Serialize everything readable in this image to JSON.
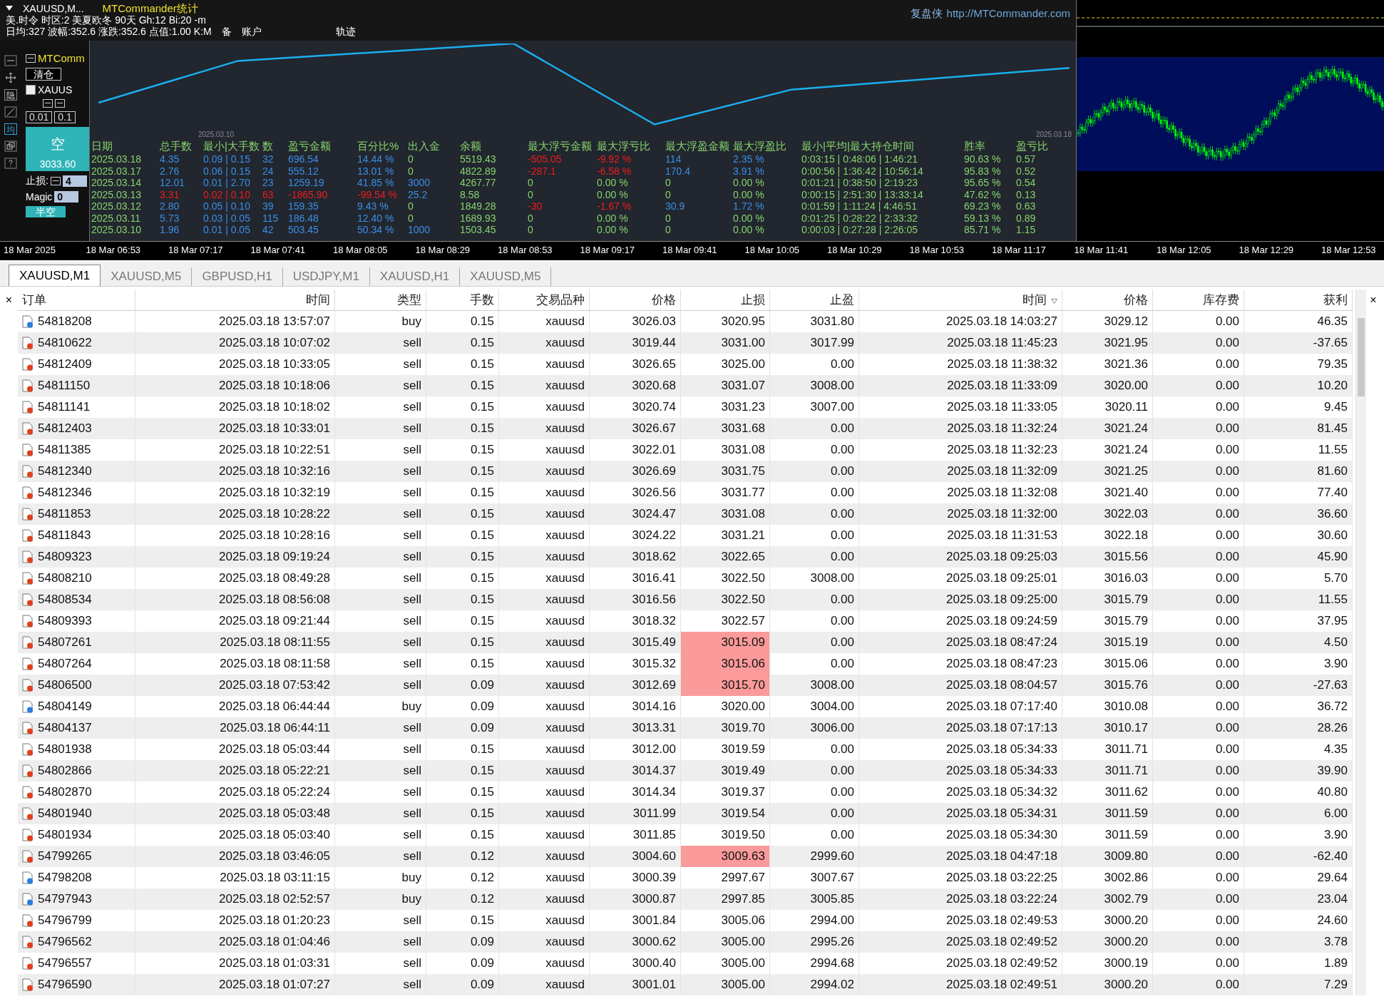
{
  "chart_header": {
    "symbol": "XAUUSD,M...",
    "title": "MTCommander统计",
    "line1": "美.时令  时区:2  美夏欧冬  90天  Gh:12 Bi:20  -m",
    "line2": [
      "日均:327  波幅:352.6  涨跌:352.6  点值:1.00  K:M",
      "备",
      "账户",
      "轨迹"
    ],
    "site_label": "复盘侠",
    "site_url": "http://MTCommander.com"
  },
  "tool_panel": {
    "title": "MTComm",
    "close_all": "清仓",
    "symbol_checkbox": {
      "label": "XAUUS",
      "checked": false
    },
    "lots": [
      "0.01",
      "0.1"
    ],
    "sell_button": {
      "label": "空",
      "price": "3033.60"
    },
    "stop_loss_label": "止损:",
    "stop_loss_value": "4",
    "magic_label": "Magic",
    "magic_value": "0",
    "half_short": "半空",
    "tool_glyphs": [
      "隐",
      "均"
    ]
  },
  "equity_chart": {
    "start_date": "2025.03.10",
    "end_date": "2025.03.18"
  },
  "stats": {
    "columns": [
      "日期",
      "总手数",
      "最小|大手数",
      "数",
      "盈亏金额",
      "百分比%",
      "出入金",
      "余额",
      "最大浮亏金额",
      "最大浮亏比",
      "最大浮盈金额",
      "最大浮盈比",
      "最小|平均|最大持仓时间",
      "胜率",
      "盈亏比"
    ],
    "rows": [
      {
        "date": "2025.03.18",
        "lots": "4.35",
        "min_max": "0.09 | 0.15",
        "count": "32",
        "pnl": "696.54",
        "pct": "14.44 %",
        "flow": "0",
        "balance": "5519.43",
        "float_loss": "-505.05",
        "float_loss_pct": "-9.92 %",
        "float_profit": "114",
        "float_profit_pct": "2.35 %",
        "hold_times": "0:03:15 | 0:48:06 | 1:46:21",
        "win_rate": "90.63 %",
        "pl_ratio": "0.57",
        "losing": false,
        "has_flow": false,
        "has_float_loss": true,
        "has_float_profit": true
      },
      {
        "date": "2025.03.17",
        "lots": "2.76",
        "min_max": "0.06 | 0.15",
        "count": "24",
        "pnl": "555.12",
        "pct": "13.01 %",
        "flow": "0",
        "balance": "4822.89",
        "float_loss": "-287.1",
        "float_loss_pct": "-6.58 %",
        "float_profit": "170.4",
        "float_profit_pct": "3.91 %",
        "hold_times": "0:00:56 | 1:36:42 | 10:56:14",
        "win_rate": "95.83 %",
        "pl_ratio": "0.52",
        "losing": false,
        "has_flow": false,
        "has_float_loss": true,
        "has_float_profit": true
      },
      {
        "date": "2025.03.14",
        "lots": "12.01",
        "min_max": "0.01 | 2.70",
        "count": "23",
        "pnl": "1259.19",
        "pct": "41.85 %",
        "flow": "3000",
        "balance": "4267.77",
        "float_loss": "0",
        "float_loss_pct": "0.00 %",
        "float_profit": "0",
        "float_profit_pct": "0.00 %",
        "hold_times": "0:01:21 | 0:38:50 | 2:19:23",
        "win_rate": "95.65 %",
        "pl_ratio": "0.54",
        "losing": false,
        "has_flow": true,
        "has_float_loss": false,
        "has_float_profit": false
      },
      {
        "date": "2025.03.13",
        "lots": "3.31",
        "min_max": "0.02 | 0.10",
        "count": "63",
        "pnl": "-1865.90",
        "pct": "-99.54 %",
        "flow": "25.2",
        "balance": "8.58",
        "float_loss": "0",
        "float_loss_pct": "0.00 %",
        "float_profit": "0",
        "float_profit_pct": "0.00 %",
        "hold_times": "0:00:15 | 2:51:30 | 13:33:14",
        "win_rate": "47.62 %",
        "pl_ratio": "0.13",
        "losing": true,
        "has_flow": true,
        "has_float_loss": false,
        "has_float_profit": false
      },
      {
        "date": "2025.03.12",
        "lots": "2.80",
        "min_max": "0.05 | 0.10",
        "count": "39",
        "pnl": "159.35",
        "pct": "9.43 %",
        "flow": "0",
        "balance": "1849.28",
        "float_loss": "-30",
        "float_loss_pct": "-1.67 %",
        "float_profit": "30.9",
        "float_profit_pct": "1.72 %",
        "hold_times": "0:01:59 | 1:11:24 | 4:46:51",
        "win_rate": "69.23 %",
        "pl_ratio": "0.63",
        "losing": false,
        "has_flow": false,
        "has_float_loss": true,
        "has_float_profit": true
      },
      {
        "date": "2025.03.11",
        "lots": "5.73",
        "min_max": "0.03 | 0.05",
        "count": "115",
        "pnl": "186.48",
        "pct": "12.40 %",
        "flow": "0",
        "balance": "1689.93",
        "float_loss": "0",
        "float_loss_pct": "0.00 %",
        "float_profit": "0",
        "float_profit_pct": "0.00 %",
        "hold_times": "0:01:25 | 0:28:22 | 2:33:32",
        "win_rate": "59.13 %",
        "pl_ratio": "0.89",
        "losing": false,
        "has_flow": false,
        "has_float_loss": false,
        "has_float_profit": false
      },
      {
        "date": "2025.03.10",
        "lots": "1.96",
        "min_max": "0.01 | 0.05",
        "count": "42",
        "pnl": "503.45",
        "pct": "50.34 %",
        "flow": "1000",
        "balance": "1503.45",
        "float_loss": "0",
        "float_loss_pct": "0.00 %",
        "float_profit": "0",
        "float_profit_pct": "0.00 %",
        "hold_times": "0:00:03 | 0:27:28 | 2:26:05",
        "win_rate": "85.71 %",
        "pl_ratio": "1.15",
        "losing": false,
        "has_flow": true,
        "has_float_loss": false,
        "has_float_profit": false
      }
    ]
  },
  "time_axis": [
    "18 Mar 2025",
    "18 Mar 06:53",
    "18 Mar 07:17",
    "18 Mar 07:41",
    "18 Mar 08:05",
    "18 Mar 08:29",
    "18 Mar 08:53",
    "18 Mar 09:17",
    "18 Mar 09:41",
    "18 Mar 10:05",
    "18 Mar 10:29",
    "18 Mar 10:53",
    "18 Mar 11:17",
    "18 Mar 11:41",
    "18 Mar 12:05",
    "18 Mar 12:29",
    "18 Mar 12:53"
  ],
  "tabs": [
    {
      "label": "XAUUSD,M1",
      "selected": true
    },
    {
      "label": "XAUUSD,M5",
      "selected": false
    },
    {
      "label": "GBPUSD,H1",
      "selected": false
    },
    {
      "label": "USDJPY,M1",
      "selected": false
    },
    {
      "label": "XAUUSD,H1",
      "selected": false
    },
    {
      "label": "XAUUSD,M5",
      "selected": false
    }
  ],
  "orders": {
    "close_glyphs": [
      "×",
      "×"
    ],
    "columns": [
      {
        "label": "订单",
        "sorted": false
      },
      {
        "label": "时间",
        "sorted": false
      },
      {
        "label": "类型",
        "sorted": false
      },
      {
        "label": "手数",
        "sorted": false
      },
      {
        "label": "交易品种",
        "sorted": false
      },
      {
        "label": "价格",
        "sorted": false
      },
      {
        "label": "止损",
        "sorted": false
      },
      {
        "label": "止盈",
        "sorted": false
      },
      {
        "label": "时间",
        "sorted": true
      },
      {
        "label": "价格",
        "sorted": false
      },
      {
        "label": "库存费",
        "sorted": false
      },
      {
        "label": "获利",
        "sorted": false
      }
    ],
    "rows": [
      {
        "order": "54818208",
        "kind": "buy",
        "open_time": "2025.03.18 13:57:07",
        "type": "buy",
        "lots": "0.15",
        "symbol": "xauusd",
        "price": "3026.03",
        "sl": "3020.95",
        "sl_hit": false,
        "tp": "3031.80",
        "close_time": "2025.03.18 14:03:27",
        "close_price": "3029.12",
        "swap": "0.00",
        "profit": "46.35"
      },
      {
        "order": "54810622",
        "kind": "sell",
        "open_time": "2025.03.18 10:07:02",
        "type": "sell",
        "lots": "0.15",
        "symbol": "xauusd",
        "price": "3019.44",
        "sl": "3031.00",
        "sl_hit": false,
        "tp": "3017.99",
        "close_time": "2025.03.18 11:45:23",
        "close_price": "3021.95",
        "swap": "0.00",
        "profit": "-37.65"
      },
      {
        "order": "54812409",
        "kind": "sell",
        "open_time": "2025.03.18 10:33:05",
        "type": "sell",
        "lots": "0.15",
        "symbol": "xauusd",
        "price": "3026.65",
        "sl": "3025.00",
        "sl_hit": false,
        "tp": "0.00",
        "close_time": "2025.03.18 11:38:32",
        "close_price": "3021.36",
        "swap": "0.00",
        "profit": "79.35"
      },
      {
        "order": "54811150",
        "kind": "sell",
        "open_time": "2025.03.18 10:18:06",
        "type": "sell",
        "lots": "0.15",
        "symbol": "xauusd",
        "price": "3020.68",
        "sl": "3031.07",
        "sl_hit": false,
        "tp": "3008.00",
        "close_time": "2025.03.18 11:33:09",
        "close_price": "3020.00",
        "swap": "0.00",
        "profit": "10.20"
      },
      {
        "order": "54811141",
        "kind": "sell",
        "open_time": "2025.03.18 10:18:02",
        "type": "sell",
        "lots": "0.15",
        "symbol": "xauusd",
        "price": "3020.74",
        "sl": "3031.23",
        "sl_hit": false,
        "tp": "3007.00",
        "close_time": "2025.03.18 11:33:05",
        "close_price": "3020.11",
        "swap": "0.00",
        "profit": "9.45"
      },
      {
        "order": "54812403",
        "kind": "sell",
        "open_time": "2025.03.18 10:33:01",
        "type": "sell",
        "lots": "0.15",
        "symbol": "xauusd",
        "price": "3026.67",
        "sl": "3031.68",
        "sl_hit": false,
        "tp": "0.00",
        "close_time": "2025.03.18 11:32:24",
        "close_price": "3021.24",
        "swap": "0.00",
        "profit": "81.45"
      },
      {
        "order": "54811385",
        "kind": "sell",
        "open_time": "2025.03.18 10:22:51",
        "type": "sell",
        "lots": "0.15",
        "symbol": "xauusd",
        "price": "3022.01",
        "sl": "3031.08",
        "sl_hit": false,
        "tp": "0.00",
        "close_time": "2025.03.18 11:32:23",
        "close_price": "3021.24",
        "swap": "0.00",
        "profit": "11.55"
      },
      {
        "order": "54812340",
        "kind": "sell",
        "open_time": "2025.03.18 10:32:16",
        "type": "sell",
        "lots": "0.15",
        "symbol": "xauusd",
        "price": "3026.69",
        "sl": "3031.75",
        "sl_hit": false,
        "tp": "0.00",
        "close_time": "2025.03.18 11:32:09",
        "close_price": "3021.25",
        "swap": "0.00",
        "profit": "81.60"
      },
      {
        "order": "54812346",
        "kind": "sell",
        "open_time": "2025.03.18 10:32:19",
        "type": "sell",
        "lots": "0.15",
        "symbol": "xauusd",
        "price": "3026.56",
        "sl": "3031.77",
        "sl_hit": false,
        "tp": "0.00",
        "close_time": "2025.03.18 11:32:08",
        "close_price": "3021.40",
        "swap": "0.00",
        "profit": "77.40"
      },
      {
        "order": "54811853",
        "kind": "sell",
        "open_time": "2025.03.18 10:28:22",
        "type": "sell",
        "lots": "0.15",
        "symbol": "xauusd",
        "price": "3024.47",
        "sl": "3031.08",
        "sl_hit": false,
        "tp": "0.00",
        "close_time": "2025.03.18 11:32:00",
        "close_price": "3022.03",
        "swap": "0.00",
        "profit": "36.60"
      },
      {
        "order": "54811843",
        "kind": "sell",
        "open_time": "2025.03.18 10:28:16",
        "type": "sell",
        "lots": "0.15",
        "symbol": "xauusd",
        "price": "3024.22",
        "sl": "3031.21",
        "sl_hit": false,
        "tp": "0.00",
        "close_time": "2025.03.18 11:31:53",
        "close_price": "3022.18",
        "swap": "0.00",
        "profit": "30.60"
      },
      {
        "order": "54809323",
        "kind": "sell",
        "open_time": "2025.03.18 09:19:24",
        "type": "sell",
        "lots": "0.15",
        "symbol": "xauusd",
        "price": "3018.62",
        "sl": "3022.65",
        "sl_hit": false,
        "tp": "0.00",
        "close_time": "2025.03.18 09:25:03",
        "close_price": "3015.56",
        "swap": "0.00",
        "profit": "45.90"
      },
      {
        "order": "54808210",
        "kind": "sell",
        "open_time": "2025.03.18 08:49:28",
        "type": "sell",
        "lots": "0.15",
        "symbol": "xauusd",
        "price": "3016.41",
        "sl": "3022.50",
        "sl_hit": false,
        "tp": "3008.00",
        "close_time": "2025.03.18 09:25:01",
        "close_price": "3016.03",
        "swap": "0.00",
        "profit": "5.70"
      },
      {
        "order": "54808534",
        "kind": "sell",
        "open_time": "2025.03.18 08:56:08",
        "type": "sell",
        "lots": "0.15",
        "symbol": "xauusd",
        "price": "3016.56",
        "sl": "3022.50",
        "sl_hit": false,
        "tp": "0.00",
        "close_time": "2025.03.18 09:25:00",
        "close_price": "3015.79",
        "swap": "0.00",
        "profit": "11.55"
      },
      {
        "order": "54809393",
        "kind": "sell",
        "open_time": "2025.03.18 09:21:44",
        "type": "sell",
        "lots": "0.15",
        "symbol": "xauusd",
        "price": "3018.32",
        "sl": "3022.57",
        "sl_hit": false,
        "tp": "0.00",
        "close_time": "2025.03.18 09:24:59",
        "close_price": "3015.79",
        "swap": "0.00",
        "profit": "37.95"
      },
      {
        "order": "54807261",
        "kind": "sell",
        "open_time": "2025.03.18 08:11:55",
        "type": "sell",
        "lots": "0.15",
        "symbol": "xauusd",
        "price": "3015.49",
        "sl": "3015.09",
        "sl_hit": true,
        "tp": "0.00",
        "close_time": "2025.03.18 08:47:24",
        "close_price": "3015.19",
        "swap": "0.00",
        "profit": "4.50"
      },
      {
        "order": "54807264",
        "kind": "sell",
        "open_time": "2025.03.18 08:11:58",
        "type": "sell",
        "lots": "0.15",
        "symbol": "xauusd",
        "price": "3015.32",
        "sl": "3015.06",
        "sl_hit": true,
        "tp": "0.00",
        "close_time": "2025.03.18 08:47:23",
        "close_price": "3015.06",
        "swap": "0.00",
        "profit": "3.90"
      },
      {
        "order": "54806500",
        "kind": "sell",
        "open_time": "2025.03.18 07:53:42",
        "type": "sell",
        "lots": "0.09",
        "symbol": "xauusd",
        "price": "3012.69",
        "sl": "3015.70",
        "sl_hit": true,
        "tp": "3008.00",
        "close_time": "2025.03.18 08:04:57",
        "close_price": "3015.76",
        "swap": "0.00",
        "profit": "-27.63"
      },
      {
        "order": "54804149",
        "kind": "buy",
        "open_time": "2025.03.18 06:44:44",
        "type": "buy",
        "lots": "0.09",
        "symbol": "xauusd",
        "price": "3014.16",
        "sl": "3020.00",
        "sl_hit": false,
        "tp": "3004.00",
        "close_time": "2025.03.18 07:17:40",
        "close_price": "3010.08",
        "swap": "0.00",
        "profit": "36.72"
      },
      {
        "order": "54804137",
        "kind": "sell",
        "open_time": "2025.03.18 06:44:11",
        "type": "sell",
        "lots": "0.09",
        "symbol": "xauusd",
        "price": "3013.31",
        "sl": "3019.70",
        "sl_hit": false,
        "tp": "3006.00",
        "close_time": "2025.03.18 07:17:13",
        "close_price": "3010.17",
        "swap": "0.00",
        "profit": "28.26"
      },
      {
        "order": "54801938",
        "kind": "sell",
        "open_time": "2025.03.18 05:03:44",
        "type": "sell",
        "lots": "0.15",
        "symbol": "xauusd",
        "price": "3012.00",
        "sl": "3019.59",
        "sl_hit": false,
        "tp": "0.00",
        "close_time": "2025.03.18 05:34:33",
        "close_price": "3011.71",
        "swap": "0.00",
        "profit": "4.35"
      },
      {
        "order": "54802866",
        "kind": "sell",
        "open_time": "2025.03.18 05:22:21",
        "type": "sell",
        "lots": "0.15",
        "symbol": "xauusd",
        "price": "3014.37",
        "sl": "3019.49",
        "sl_hit": false,
        "tp": "0.00",
        "close_time": "2025.03.18 05:34:33",
        "close_price": "3011.71",
        "swap": "0.00",
        "profit": "39.90"
      },
      {
        "order": "54802870",
        "kind": "sell",
        "open_time": "2025.03.18 05:22:24",
        "type": "sell",
        "lots": "0.15",
        "symbol": "xauusd",
        "price": "3014.34",
        "sl": "3019.37",
        "sl_hit": false,
        "tp": "0.00",
        "close_time": "2025.03.18 05:34:32",
        "close_price": "3011.62",
        "swap": "0.00",
        "profit": "40.80"
      },
      {
        "order": "54801940",
        "kind": "sell",
        "open_time": "2025.03.18 05:03:48",
        "type": "sell",
        "lots": "0.15",
        "symbol": "xauusd",
        "price": "3011.99",
        "sl": "3019.54",
        "sl_hit": false,
        "tp": "0.00",
        "close_time": "2025.03.18 05:34:31",
        "close_price": "3011.59",
        "swap": "0.00",
        "profit": "6.00"
      },
      {
        "order": "54801934",
        "kind": "sell",
        "open_time": "2025.03.18 05:03:40",
        "type": "sell",
        "lots": "0.15",
        "symbol": "xauusd",
        "price": "3011.85",
        "sl": "3019.50",
        "sl_hit": false,
        "tp": "0.00",
        "close_time": "2025.03.18 05:34:30",
        "close_price": "3011.59",
        "swap": "0.00",
        "profit": "3.90"
      },
      {
        "order": "54799265",
        "kind": "sell",
        "open_time": "2025.03.18 03:46:05",
        "type": "sell",
        "lots": "0.12",
        "symbol": "xauusd",
        "price": "3004.60",
        "sl": "3009.63",
        "sl_hit": true,
        "tp": "2999.60",
        "close_time": "2025.03.18 04:47:18",
        "close_price": "3009.80",
        "swap": "0.00",
        "profit": "-62.40"
      },
      {
        "order": "54798208",
        "kind": "buy",
        "open_time": "2025.03.18 03:11:15",
        "type": "buy",
        "lots": "0.12",
        "symbol": "xauusd",
        "price": "3000.39",
        "sl": "2997.67",
        "sl_hit": false,
        "tp": "3007.67",
        "close_time": "2025.03.18 03:22:25",
        "close_price": "3002.86",
        "swap": "0.00",
        "profit": "29.64"
      },
      {
        "order": "54797943",
        "kind": "buy",
        "open_time": "2025.03.18 02:52:57",
        "type": "buy",
        "lots": "0.12",
        "symbol": "xauusd",
        "price": "3000.87",
        "sl": "2997.85",
        "sl_hit": false,
        "tp": "3005.85",
        "close_time": "2025.03.18 03:22:24",
        "close_price": "3002.79",
        "swap": "0.00",
        "profit": "23.04"
      },
      {
        "order": "54796799",
        "kind": "sell",
        "open_time": "2025.03.18 01:20:23",
        "type": "sell",
        "lots": "0.15",
        "symbol": "xauusd",
        "price": "3001.84",
        "sl": "3005.06",
        "sl_hit": false,
        "tp": "2994.00",
        "close_time": "2025.03.18 02:49:53",
        "close_price": "3000.20",
        "swap": "0.00",
        "profit": "24.60"
      },
      {
        "order": "54796562",
        "kind": "sell",
        "open_time": "2025.03.18 01:04:46",
        "type": "sell",
        "lots": "0.09",
        "symbol": "xauusd",
        "price": "3000.62",
        "sl": "3005.00",
        "sl_hit": false,
        "tp": "2995.26",
        "close_time": "2025.03.18 02:49:52",
        "close_price": "3000.20",
        "swap": "0.00",
        "profit": "3.78"
      },
      {
        "order": "54796557",
        "kind": "sell",
        "open_time": "2025.03.18 01:03:31",
        "type": "sell",
        "lots": "0.09",
        "symbol": "xauusd",
        "price": "3000.40",
        "sl": "3005.00",
        "sl_hit": false,
        "tp": "2994.68",
        "close_time": "2025.03.18 02:49:52",
        "close_price": "3000.19",
        "swap": "0.00",
        "profit": "1.89"
      },
      {
        "order": "54796590",
        "kind": "sell",
        "open_time": "2025.03.18 01:07:27",
        "type": "sell",
        "lots": "0.09",
        "symbol": "xauusd",
        "price": "3001.01",
        "sl": "3005.00",
        "sl_hit": false,
        "tp": "2994.02",
        "close_time": "2025.03.18 02:49:51",
        "close_price": "3000.20",
        "swap": "0.00",
        "profit": "7.29"
      }
    ]
  }
}
